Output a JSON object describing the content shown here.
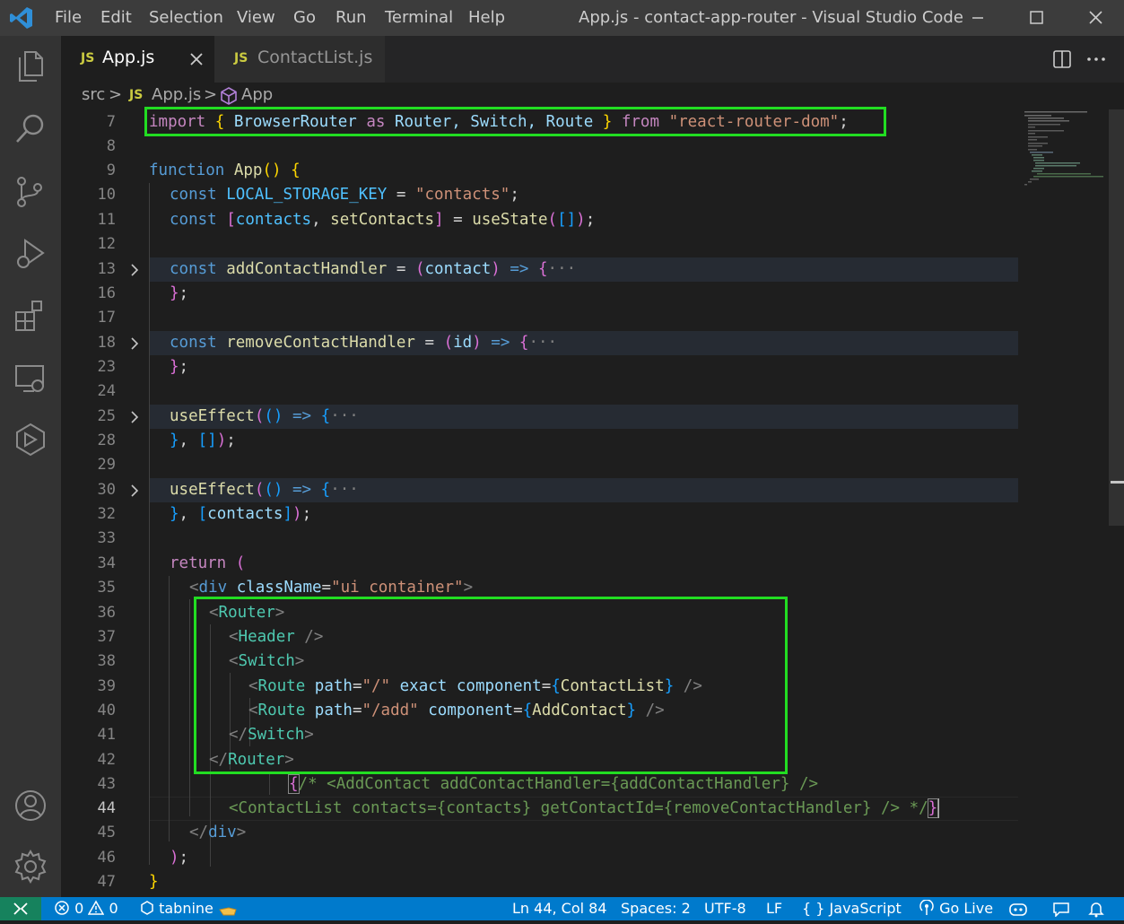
{
  "window": {
    "title": "App.js - contact-app-router - Visual Studio Code",
    "menu": [
      "File",
      "Edit",
      "Selection",
      "View",
      "Go",
      "Run",
      "Terminal",
      "Help"
    ]
  },
  "activity_bar": {
    "items": [
      "files-icon",
      "search-icon",
      "source-control-icon",
      "run-debug-icon",
      "extensions-icon",
      "remote-explorer-icon",
      "deploy-icon"
    ],
    "bottom_items": [
      "account-icon",
      "settings-gear-icon"
    ]
  },
  "tabs": [
    {
      "badge": "JS",
      "label": "App.js",
      "active": true
    },
    {
      "badge": "JS",
      "label": "ContactList.js",
      "active": false
    }
  ],
  "breadcrumb": {
    "folder": "src",
    "sep": ">",
    "file_badge": "JS",
    "file": "App.js",
    "symbol": "App"
  },
  "editor": {
    "active_line": "44",
    "lines": [
      {
        "n": "7"
      },
      {
        "n": "8"
      },
      {
        "n": "9"
      },
      {
        "n": "10"
      },
      {
        "n": "11"
      },
      {
        "n": "12"
      },
      {
        "n": "13"
      },
      {
        "n": "16"
      },
      {
        "n": "17"
      },
      {
        "n": "18"
      },
      {
        "n": "23"
      },
      {
        "n": "24"
      },
      {
        "n": "25"
      },
      {
        "n": "28"
      },
      {
        "n": "29"
      },
      {
        "n": "30"
      },
      {
        "n": "32"
      },
      {
        "n": "33"
      },
      {
        "n": "34"
      },
      {
        "n": "35"
      },
      {
        "n": "36"
      },
      {
        "n": "37"
      },
      {
        "n": "38"
      },
      {
        "n": "39"
      },
      {
        "n": "40"
      },
      {
        "n": "41"
      },
      {
        "n": "42"
      },
      {
        "n": "43"
      },
      {
        "n": "44"
      },
      {
        "n": "45"
      },
      {
        "n": "46"
      },
      {
        "n": "47"
      }
    ],
    "tokens": {
      "l7": [
        "import",
        " ",
        "{",
        " BrowserRouter ",
        "as",
        " Router, Switch, Route ",
        "}",
        " ",
        "from",
        " ",
        "\"react-router-dom\"",
        ";"
      ],
      "l9": [
        "function",
        " ",
        "App",
        "(",
        ")",
        " ",
        "{"
      ],
      "l10": [
        "const",
        " ",
        "LOCAL_STORAGE_KEY",
        " = ",
        "\"contacts\"",
        ";"
      ],
      "l11": [
        "const",
        " ",
        "[",
        "contacts",
        ", ",
        "setContacts",
        "]",
        " = ",
        "useState",
        "(",
        "[",
        "]",
        ")",
        ";"
      ],
      "l13": [
        "const",
        " ",
        "addContactHandler",
        " = ",
        "(",
        "contact",
        ")",
        " ",
        "=>",
        " ",
        "{",
        "···"
      ],
      "l16": [
        "}",
        ";"
      ],
      "l18": [
        "const",
        " ",
        "removeContactHandler",
        " = ",
        "(",
        "id",
        ")",
        " ",
        "=>",
        " ",
        "{",
        "···"
      ],
      "l23": [
        "}",
        ";"
      ],
      "l25": [
        "useEffect",
        "(",
        "(",
        ")",
        " ",
        "=>",
        " ",
        "{",
        "···"
      ],
      "l28": [
        "}",
        ", ",
        "[",
        "]",
        ")",
        ";"
      ],
      "l30": [
        "useEffect",
        "(",
        "(",
        ")",
        " ",
        "=>",
        " ",
        "{",
        "···"
      ],
      "l32": [
        "}",
        ", ",
        "[",
        "contacts",
        "]",
        ")",
        ";"
      ],
      "l34": [
        "return",
        " ",
        "("
      ],
      "l35": [
        "<",
        "div",
        " ",
        "className",
        "=",
        "\"ui container\"",
        ">"
      ],
      "l36": [
        "<",
        "Router",
        ">"
      ],
      "l37": [
        "<",
        "Header",
        " />"
      ],
      "l38": [
        "<",
        "Switch",
        ">"
      ],
      "l39": [
        "<",
        "Route",
        " ",
        "path",
        "=",
        "\"/\"",
        " ",
        "exact",
        " ",
        "component",
        "=",
        "{",
        "ContactList",
        "}",
        " />"
      ],
      "l40": [
        "<",
        "Route",
        " ",
        "path",
        "=",
        "\"/add\"",
        " ",
        "component",
        "=",
        "{",
        "AddContact",
        "}",
        " />"
      ],
      "l41": [
        "</",
        "Switch",
        ">"
      ],
      "l42": [
        "</",
        "Router",
        ">"
      ],
      "l43": [
        "{",
        "/* <AddContact addContactHandler={addContactHandler} />"
      ],
      "l44": [
        "<ContactList contacts={contacts} getContactId={removeContactHandler} /> */",
        "}"
      ],
      "l45": [
        "</",
        "div",
        ">"
      ],
      "l46": [
        ")",
        ";"
      ],
      "l47": [
        "}"
      ]
    }
  },
  "statusbar": {
    "errors": "0",
    "warnings": "0",
    "tabnine": "tabnine",
    "position": "Ln 44, Col 84",
    "spaces": "Spaces: 2",
    "encoding": "UTF-8",
    "eol": "LF",
    "language_glyph": "{ }",
    "language": "JavaScript",
    "golive": "Go Live"
  },
  "colors": {
    "accent": "#007acc",
    "highlight_box": "#22dd22",
    "remote": "#16825d"
  }
}
